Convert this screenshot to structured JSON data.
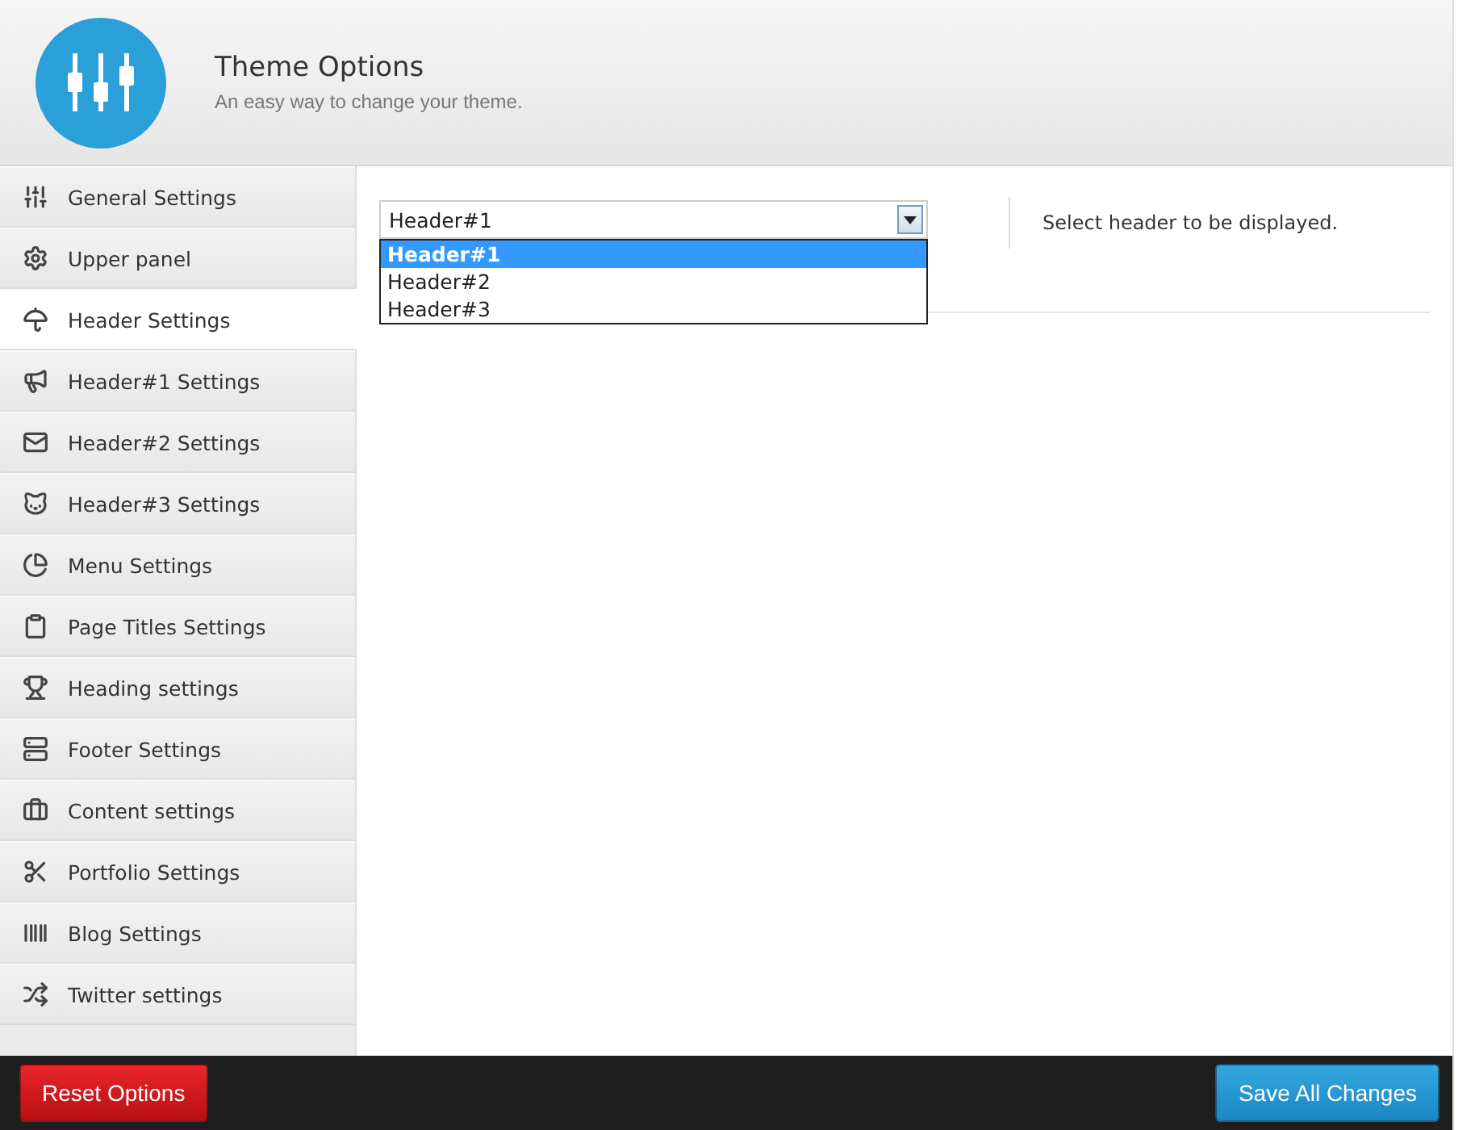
{
  "header": {
    "title": "Theme Options",
    "subtitle": "An easy way to change your theme."
  },
  "sidebar": {
    "items": [
      {
        "label": "General Settings",
        "selected": false
      },
      {
        "label": "Upper panel",
        "selected": false
      },
      {
        "label": "Header Settings",
        "selected": true
      },
      {
        "label": "Header#1 Settings",
        "selected": false
      },
      {
        "label": "Header#2 Settings",
        "selected": false
      },
      {
        "label": "Header#3 Settings",
        "selected": false
      },
      {
        "label": "Menu Settings",
        "selected": false
      },
      {
        "label": "Page Titles Settings",
        "selected": false
      },
      {
        "label": "Heading settings",
        "selected": false
      },
      {
        "label": "Footer Settings",
        "selected": false
      },
      {
        "label": "Content settings",
        "selected": false
      },
      {
        "label": "Portfolio Settings",
        "selected": false
      },
      {
        "label": "Blog Settings",
        "selected": false
      },
      {
        "label": "Twitter settings",
        "selected": false
      }
    ]
  },
  "header_select": {
    "value": "Header#1",
    "expanded": true,
    "options": [
      {
        "label": "Header#1",
        "selected": true
      },
      {
        "label": "Header#2",
        "selected": false
      },
      {
        "label": "Header#3",
        "selected": false
      }
    ],
    "description": "Select header to be displayed."
  },
  "footer": {
    "reset_button": "Reset Options",
    "save_button": "Save All Changes"
  }
}
